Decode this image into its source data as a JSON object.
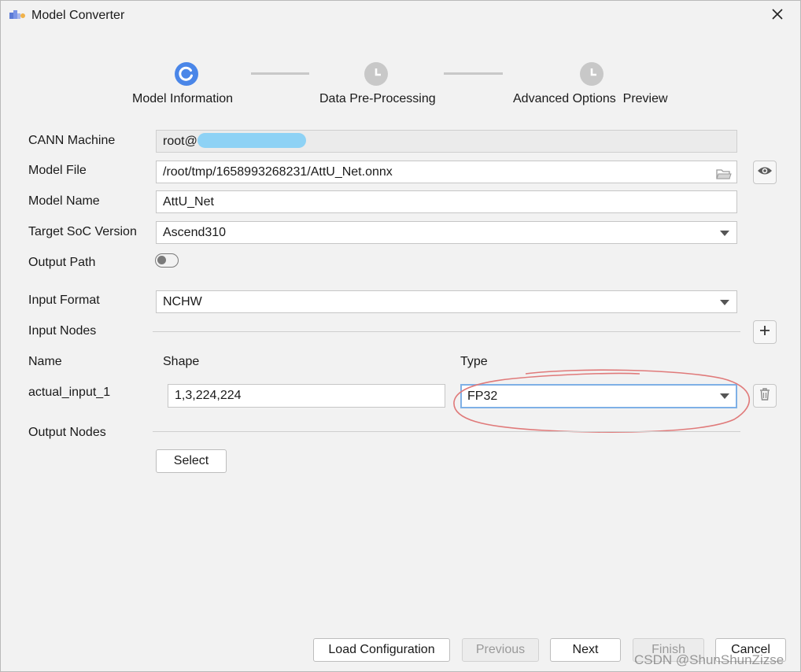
{
  "window": {
    "title": "Model Converter"
  },
  "steps": [
    {
      "label": "Model Information",
      "state": "active"
    },
    {
      "label": "Data Pre-Processing",
      "state": "pending"
    },
    {
      "label": "Advanced Options  Preview",
      "state": "pending"
    }
  ],
  "form": {
    "cann_machine": {
      "label": "CANN Machine",
      "value": "root@"
    },
    "model_file": {
      "label": "Model File",
      "value": "/root/tmp/1658993268231/AttU_Net.onnx"
    },
    "model_name": {
      "label": "Model Name",
      "value": "AttU_Net"
    },
    "target_soc": {
      "label": "Target SoC Version",
      "value": "Ascend310"
    },
    "output_path": {
      "label": "Output Path",
      "enabled": false
    },
    "input_format": {
      "label": "Input Format",
      "value": "NCHW"
    },
    "input_nodes": {
      "label": "Input Nodes",
      "columns": {
        "name": "Name",
        "shape": "Shape",
        "type": "Type"
      },
      "rows": [
        {
          "name": "actual_input_1",
          "shape": "1,3,224,224",
          "type": "FP32"
        }
      ]
    },
    "output_nodes": {
      "label": "Output Nodes",
      "select_label": "Select"
    }
  },
  "footer": {
    "load_configuration": "Load Configuration",
    "previous": "Previous",
    "next": "Next",
    "finish": "Finish",
    "cancel": "Cancel"
  },
  "watermark": "CSDN @ShunShunZizse",
  "colors": {
    "accent": "#4a86e8",
    "pending_step": "#c8c8c8",
    "annotation": "#e07a7a",
    "focus_border": "#7fb0e6"
  },
  "icons": {
    "close": "close-icon",
    "folder": "folder-icon",
    "eye": "eye-icon",
    "plus": "plus-icon",
    "trash": "trash-icon"
  }
}
